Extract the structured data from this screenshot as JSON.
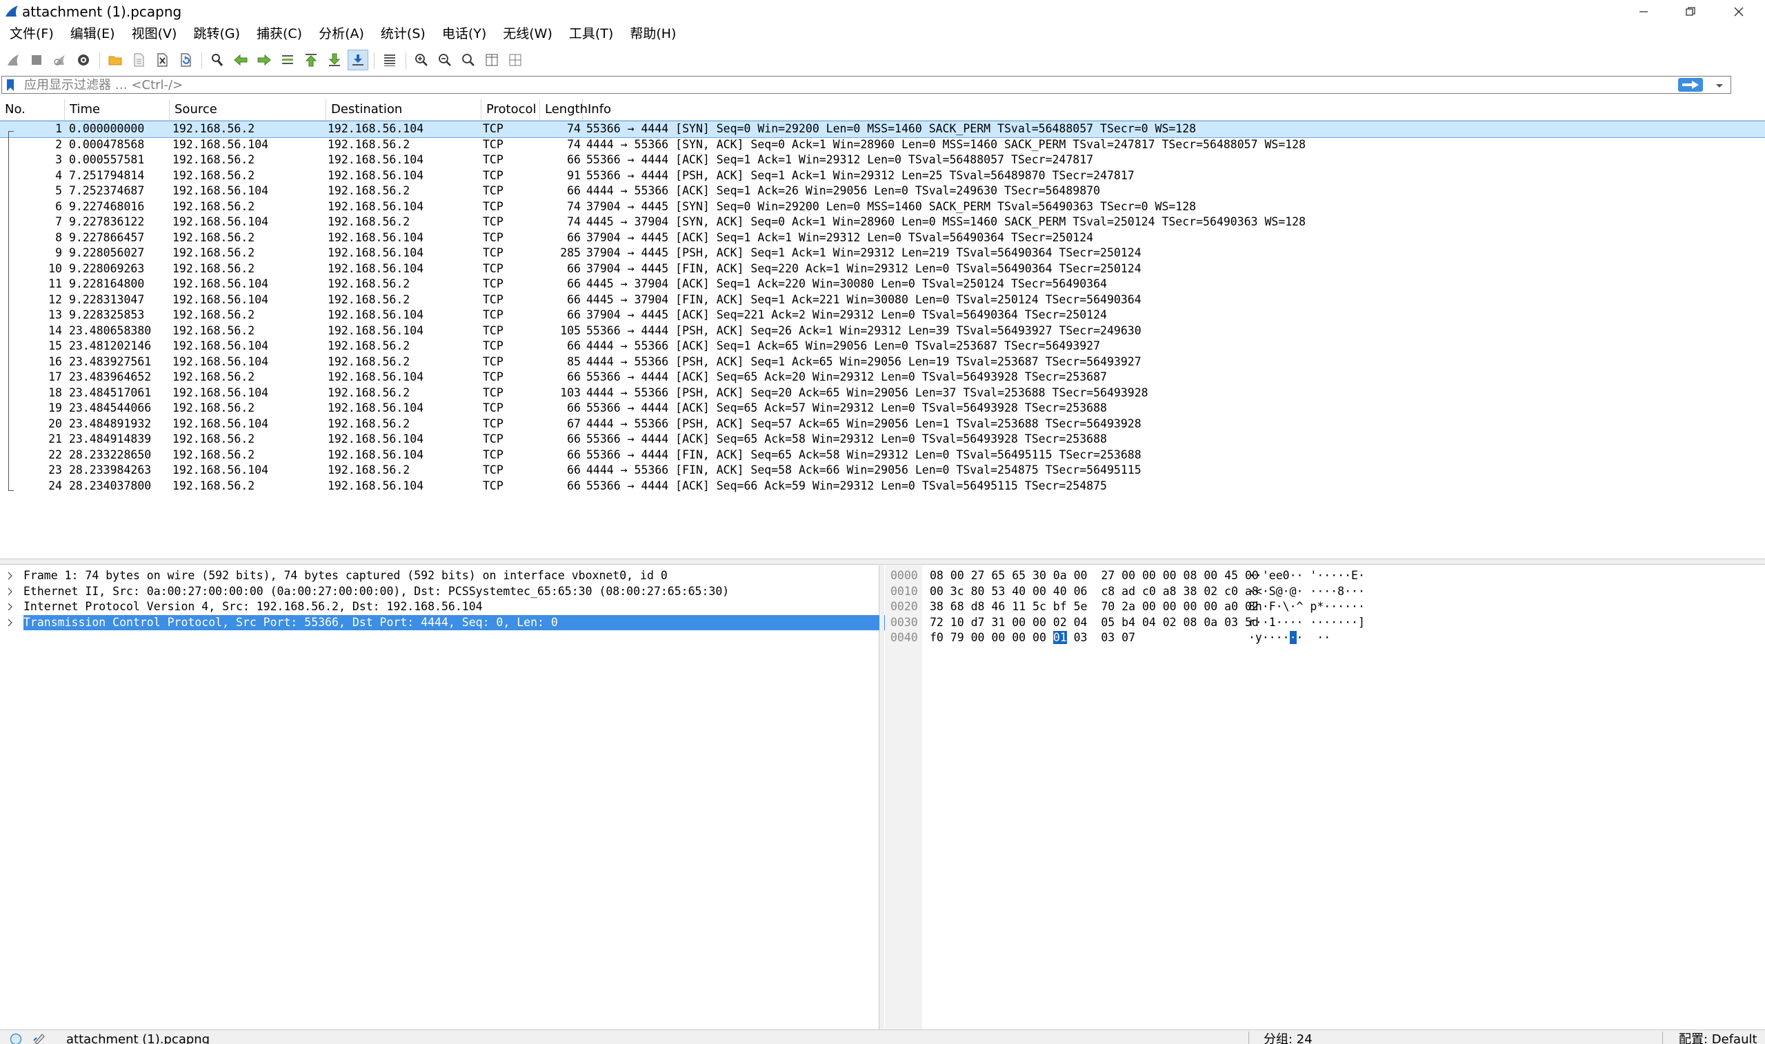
{
  "window": {
    "title": "attachment (1).pcapng"
  },
  "menu": [
    "文件(F)",
    "编辑(E)",
    "视图(V)",
    "跳转(G)",
    "捕获(C)",
    "分析(A)",
    "统计(S)",
    "电话(Y)",
    "无线(W)",
    "工具(T)",
    "帮助(H)"
  ],
  "filter": {
    "placeholder": "应用显示过滤器 … <Ctrl-/>",
    "add_label": "+"
  },
  "packet_list": {
    "columns": [
      "No.",
      "Time",
      "Source",
      "Destination",
      "Protocol",
      "Length",
      "Info"
    ],
    "selected_index": 0,
    "rows": [
      {
        "no": "1",
        "time": "0.000000000",
        "src": "192.168.56.2",
        "dst": "192.168.56.104",
        "proto": "TCP",
        "len": "74",
        "info": "55366 → 4444 [SYN] Seq=0 Win=29200 Len=0 MSS=1460 SACK_PERM TSval=56488057 TSecr=0 WS=128"
      },
      {
        "no": "2",
        "time": "0.000478568",
        "src": "192.168.56.104",
        "dst": "192.168.56.2",
        "proto": "TCP",
        "len": "74",
        "info": "4444 → 55366 [SYN, ACK] Seq=0 Ack=1 Win=28960 Len=0 MSS=1460 SACK_PERM TSval=247817 TSecr=56488057 WS=128"
      },
      {
        "no": "3",
        "time": "0.000557581",
        "src": "192.168.56.2",
        "dst": "192.168.56.104",
        "proto": "TCP",
        "len": "66",
        "info": "55366 → 4444 [ACK] Seq=1 Ack=1 Win=29312 Len=0 TSval=56488057 TSecr=247817"
      },
      {
        "no": "4",
        "time": "7.251794814",
        "src": "192.168.56.2",
        "dst": "192.168.56.104",
        "proto": "TCP",
        "len": "91",
        "info": "55366 → 4444 [PSH, ACK] Seq=1 Ack=1 Win=29312 Len=25 TSval=56489870 TSecr=247817"
      },
      {
        "no": "5",
        "time": "7.252374687",
        "src": "192.168.56.104",
        "dst": "192.168.56.2",
        "proto": "TCP",
        "len": "66",
        "info": "4444 → 55366 [ACK] Seq=1 Ack=26 Win=29056 Len=0 TSval=249630 TSecr=56489870"
      },
      {
        "no": "6",
        "time": "9.227468016",
        "src": "192.168.56.2",
        "dst": "192.168.56.104",
        "proto": "TCP",
        "len": "74",
        "info": "37904 → 4445 [SYN] Seq=0 Win=29200 Len=0 MSS=1460 SACK_PERM TSval=56490363 TSecr=0 WS=128"
      },
      {
        "no": "7",
        "time": "9.227836122",
        "src": "192.168.56.104",
        "dst": "192.168.56.2",
        "proto": "TCP",
        "len": "74",
        "info": "4445 → 37904 [SYN, ACK] Seq=0 Ack=1 Win=28960 Len=0 MSS=1460 SACK_PERM TSval=250124 TSecr=56490363 WS=128"
      },
      {
        "no": "8",
        "time": "9.227866457",
        "src": "192.168.56.2",
        "dst": "192.168.56.104",
        "proto": "TCP",
        "len": "66",
        "info": "37904 → 4445 [ACK] Seq=1 Ack=1 Win=29312 Len=0 TSval=56490364 TSecr=250124"
      },
      {
        "no": "9",
        "time": "9.228056027",
        "src": "192.168.56.2",
        "dst": "192.168.56.104",
        "proto": "TCP",
        "len": "285",
        "info": "37904 → 4445 [PSH, ACK] Seq=1 Ack=1 Win=29312 Len=219 TSval=56490364 TSecr=250124"
      },
      {
        "no": "10",
        "time": "9.228069263",
        "src": "192.168.56.2",
        "dst": "192.168.56.104",
        "proto": "TCP",
        "len": "66",
        "info": "37904 → 4445 [FIN, ACK] Seq=220 Ack=1 Win=29312 Len=0 TSval=56490364 TSecr=250124"
      },
      {
        "no": "11",
        "time": "9.228164800",
        "src": "192.168.56.104",
        "dst": "192.168.56.2",
        "proto": "TCP",
        "len": "66",
        "info": "4445 → 37904 [ACK] Seq=1 Ack=220 Win=30080 Len=0 TSval=250124 TSecr=56490364"
      },
      {
        "no": "12",
        "time": "9.228313047",
        "src": "192.168.56.104",
        "dst": "192.168.56.2",
        "proto": "TCP",
        "len": "66",
        "info": "4445 → 37904 [FIN, ACK] Seq=1 Ack=221 Win=30080 Len=0 TSval=250124 TSecr=56490364"
      },
      {
        "no": "13",
        "time": "9.228325853",
        "src": "192.168.56.2",
        "dst": "192.168.56.104",
        "proto": "TCP",
        "len": "66",
        "info": "37904 → 4445 [ACK] Seq=221 Ack=2 Win=29312 Len=0 TSval=56490364 TSecr=250124"
      },
      {
        "no": "14",
        "time": "23.480658380",
        "src": "192.168.56.2",
        "dst": "192.168.56.104",
        "proto": "TCP",
        "len": "105",
        "info": "55366 → 4444 [PSH, ACK] Seq=26 Ack=1 Win=29312 Len=39 TSval=56493927 TSecr=249630"
      },
      {
        "no": "15",
        "time": "23.481202146",
        "src": "192.168.56.104",
        "dst": "192.168.56.2",
        "proto": "TCP",
        "len": "66",
        "info": "4444 → 55366 [ACK] Seq=1 Ack=65 Win=29056 Len=0 TSval=253687 TSecr=56493927"
      },
      {
        "no": "16",
        "time": "23.483927561",
        "src": "192.168.56.104",
        "dst": "192.168.56.2",
        "proto": "TCP",
        "len": "85",
        "info": "4444 → 55366 [PSH, ACK] Seq=1 Ack=65 Win=29056 Len=19 TSval=253687 TSecr=56493927"
      },
      {
        "no": "17",
        "time": "23.483964652",
        "src": "192.168.56.2",
        "dst": "192.168.56.104",
        "proto": "TCP",
        "len": "66",
        "info": "55366 → 4444 [ACK] Seq=65 Ack=20 Win=29312 Len=0 TSval=56493928 TSecr=253687"
      },
      {
        "no": "18",
        "time": "23.484517061",
        "src": "192.168.56.104",
        "dst": "192.168.56.2",
        "proto": "TCP",
        "len": "103",
        "info": "4444 → 55366 [PSH, ACK] Seq=20 Ack=65 Win=29056 Len=37 TSval=253688 TSecr=56493928"
      },
      {
        "no": "19",
        "time": "23.484544066",
        "src": "192.168.56.2",
        "dst": "192.168.56.104",
        "proto": "TCP",
        "len": "66",
        "info": "55366 → 4444 [ACK] Seq=65 Ack=57 Win=29312 Len=0 TSval=56493928 TSecr=253688"
      },
      {
        "no": "20",
        "time": "23.484891932",
        "src": "192.168.56.104",
        "dst": "192.168.56.2",
        "proto": "TCP",
        "len": "67",
        "info": "4444 → 55366 [PSH, ACK] Seq=57 Ack=65 Win=29056 Len=1 TSval=253688 TSecr=56493928"
      },
      {
        "no": "21",
        "time": "23.484914839",
        "src": "192.168.56.2",
        "dst": "192.168.56.104",
        "proto": "TCP",
        "len": "66",
        "info": "55366 → 4444 [ACK] Seq=65 Ack=58 Win=29312 Len=0 TSval=56493928 TSecr=253688"
      },
      {
        "no": "22",
        "time": "28.233228650",
        "src": "192.168.56.2",
        "dst": "192.168.56.104",
        "proto": "TCP",
        "len": "66",
        "info": "55366 → 4444 [FIN, ACK] Seq=65 Ack=58 Win=29312 Len=0 TSval=56495115 TSecr=253688"
      },
      {
        "no": "23",
        "time": "28.233984263",
        "src": "192.168.56.104",
        "dst": "192.168.56.2",
        "proto": "TCP",
        "len": "66",
        "info": "4444 → 55366 [FIN, ACK] Seq=58 Ack=66 Win=29056 Len=0 TSval=254875 TSecr=56495115"
      },
      {
        "no": "24",
        "time": "28.234037800",
        "src": "192.168.56.2",
        "dst": "192.168.56.104",
        "proto": "TCP",
        "len": "66",
        "info": "55366 → 4444 [ACK] Seq=66 Ack=59 Win=29312 Len=0 TSval=56495115 TSecr=254875"
      }
    ]
  },
  "details": {
    "selected_index": 3,
    "items": [
      "Frame 1: 74 bytes on wire (592 bits), 74 bytes captured (592 bits) on interface vboxnet0, id 0",
      "Ethernet II, Src: 0a:00:27:00:00:00 (0a:00:27:00:00:00), Dst: PCSSystemtec_65:65:30 (08:00:27:65:65:30)",
      "Internet Protocol Version 4, Src: 192.168.56.2, Dst: 192.168.56.104",
      "Transmission Control Protocol, Src Port: 55366, Dst Port: 4444, Seq: 0, Len: 0"
    ]
  },
  "bytes": {
    "rows": [
      {
        "offset": "0000",
        "hex": "08 00 27 65 65 30 0a 00  27 00 00 00 08 00 45 00",
        "ascii": "··'ee0·· '·····E·"
      },
      {
        "offset": "0010",
        "hex": "00 3c 80 53 40 00 40 06  c8 ad c0 a8 38 02 c0 a8",
        "ascii": "·<·S@·@· ····8···"
      },
      {
        "offset": "0020",
        "hex": "38 68 d8 46 11 5c bf 5e  70 2a 00 00 00 00 a0 02",
        "ascii": "8h·F·\\·^ p*······"
      },
      {
        "offset": "0030",
        "hex": "72 10 d7 31 00 00 02 04  05 b4 04 02 08 0a 03 5d",
        "ascii": "r··1···· ·······]"
      },
      {
        "offset": "0040",
        "hex_before": "f0 79 00 00 00 00 ",
        "hex_hl": "01",
        "hex_after": " 03  03 07",
        "ascii_before": "·y····",
        "ascii_hl": "·",
        "ascii_after": "·  ··"
      }
    ]
  },
  "status": {
    "file": "attachment (1).pcapng",
    "packets": "分组: 24",
    "profile": "配置: Default"
  },
  "colors": {
    "selection_row": "#cce8ff",
    "selection_tree": "#3d8ee5",
    "hex_highlight": "#1565c0"
  }
}
